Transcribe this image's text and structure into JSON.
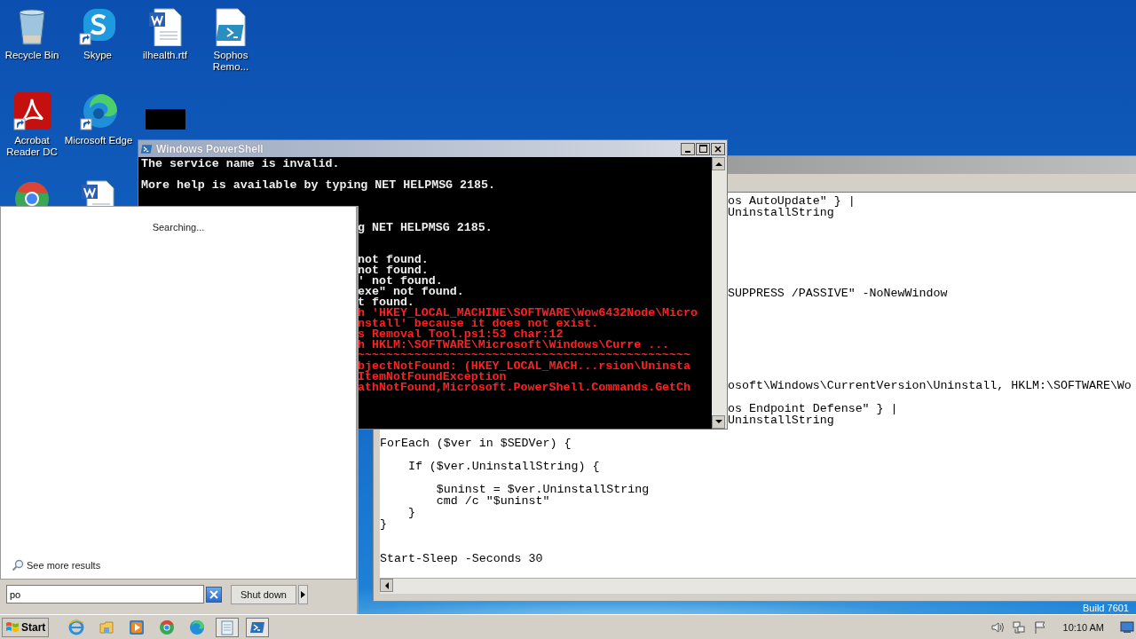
{
  "desktop": {
    "icons": [
      {
        "label": "Recycle Bin",
        "kind": "recycle",
        "shortcut": false
      },
      {
        "label": "Skype",
        "kind": "skype",
        "shortcut": true
      },
      {
        "label": "ilhealth.rtf",
        "kind": "word",
        "shortcut": false
      },
      {
        "label": "Sophos Remo...",
        "kind": "script",
        "shortcut": false
      },
      {
        "label": "Acrobat Reader DC",
        "kind": "acrobat",
        "shortcut": true
      },
      {
        "label": "Microsoft Edge",
        "kind": "edge",
        "shortcut": true
      },
      {
        "kind": "redacted"
      },
      {
        "kind": "chrome",
        "shortcut": false
      },
      {
        "kind": "word",
        "shortcut": false
      }
    ],
    "build": "Build 7601"
  },
  "editor": {
    "lines": [
      {
        "kind": "code",
        "text": "os AutoUpdate\" } |",
        "partial": true
      },
      {
        "kind": "code",
        "text": "UninstallString",
        "partial": true
      },
      {
        "kind": "blank"
      },
      {
        "kind": "blank"
      },
      {
        "kind": "blank"
      },
      {
        "kind": "blank"
      },
      {
        "kind": "blank"
      },
      {
        "kind": "blank"
      },
      {
        "kind": "code",
        "text": "SUPPRESS /PASSIVE\" -NoNewWindow",
        "partial": true
      },
      {
        "kind": "blank"
      },
      {
        "kind": "blank"
      },
      {
        "kind": "blank"
      },
      {
        "kind": "blank"
      },
      {
        "kind": "blank"
      },
      {
        "kind": "blank"
      },
      {
        "kind": "blank"
      },
      {
        "kind": "code",
        "text": "osoft\\Windows\\CurrentVersion\\Uninstall, HKLM:\\SOFTWARE\\Wo",
        "partial": true
      },
      {
        "kind": "blank"
      },
      {
        "kind": "code",
        "text": "os Endpoint Defense\" } |",
        "partial": true
      },
      {
        "kind": "code",
        "text": "UninstallString",
        "partial": true
      },
      {
        "kind": "blank"
      },
      {
        "kind": "code",
        "text": "ForEach ($ver in $SEDVer) {",
        "partial": false
      },
      {
        "kind": "blank"
      },
      {
        "kind": "code",
        "text": "    If ($ver.UninstallString) {",
        "partial": false
      },
      {
        "kind": "blank"
      },
      {
        "kind": "code",
        "text": "        $uninst = $ver.UninstallString",
        "partial": false
      },
      {
        "kind": "code",
        "text": "        cmd /c \"$uninst\"",
        "partial": false
      },
      {
        "kind": "code",
        "text": "    }",
        "partial": false
      },
      {
        "kind": "code",
        "text": "}",
        "partial": false
      },
      {
        "kind": "blank"
      },
      {
        "kind": "blank"
      },
      {
        "kind": "code",
        "text": "Start-Sleep -Seconds 30",
        "partial": false
      }
    ]
  },
  "console": {
    "title": "Windows PowerShell",
    "lines": [
      {
        "kind": "output",
        "text": "The service name is invalid.",
        "partial": false
      },
      {
        "kind": "blank"
      },
      {
        "kind": "output",
        "text": "More help is available by typing NET HELPMSG 2185.",
        "partial": false
      },
      {
        "kind": "blank"
      },
      {
        "kind": "blank"
      },
      {
        "kind": "blank"
      },
      {
        "kind": "output",
        "text": "g NET HELPMSG 2185.",
        "partial": true
      },
      {
        "kind": "blank"
      },
      {
        "kind": "blank"
      },
      {
        "kind": "output",
        "text": "not found.",
        "partial": true
      },
      {
        "kind": "output",
        "text": "not found.",
        "partial": true
      },
      {
        "kind": "output",
        "text": "' not found.",
        "partial": true
      },
      {
        "kind": "output",
        "text": "exe\" not found.",
        "partial": true
      },
      {
        "kind": "output",
        "text": "t found.",
        "partial": true
      },
      {
        "kind": "error",
        "text": "h 'HKEY_LOCAL_MACHINE\\SOFTWARE\\Wow6432Node\\Micro",
        "partial": true
      },
      {
        "kind": "error",
        "text": "nstall' because it does not exist.",
        "partial": true
      },
      {
        "kind": "error",
        "text": "s Removal Tool.ps1:53 char:12",
        "partial": true
      },
      {
        "kind": "error",
        "text": "h HKLM:\\SOFTWARE\\Microsoft\\Windows\\Curre ...",
        "partial": true
      },
      {
        "kind": "error",
        "text": "~~~~~~~~~~~~~~~~~~~~~~~~~~~~~~~~~~~~~~~~~~~~~~~",
        "partial": true
      },
      {
        "kind": "error",
        "text": "bjectNotFound: (HKEY_LOCAL_MACH...rsion\\Uninsta",
        "partial": true
      },
      {
        "kind": "error",
        "text": "ItemNotFoundException",
        "partial": true
      },
      {
        "kind": "error",
        "text": "athNotFound,Microsoft.PowerShell.Commands.GetCh",
        "partial": true
      }
    ]
  },
  "start_menu": {
    "status": "Searching...",
    "more_results": "See more results",
    "search": {
      "value": "po"
    },
    "shutdown": "Shut down"
  },
  "taskbar": {
    "start": "Start",
    "apps": [
      {
        "kind": "ie",
        "open": false
      },
      {
        "kind": "explorer",
        "open": false
      },
      {
        "kind": "media",
        "open": false
      },
      {
        "kind": "chrome",
        "open": false
      },
      {
        "kind": "edge",
        "open": false
      },
      {
        "kind": "notepad",
        "open": true
      },
      {
        "kind": "powershell",
        "open": true
      }
    ],
    "clock": "10:10 AM"
  }
}
